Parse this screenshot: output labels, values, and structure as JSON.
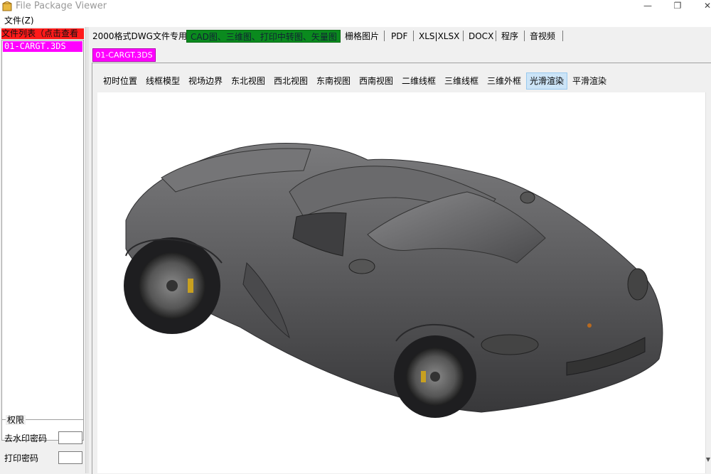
{
  "window": {
    "title": "File Package Viewer",
    "minimize_glyph": "—",
    "restore_glyph": "❐",
    "close_glyph": "✕"
  },
  "menu": {
    "file": "文件(Z)"
  },
  "file_list": {
    "header": "文件列表（点击查看",
    "items": [
      "01-CARGT.3DS"
    ]
  },
  "permissions": {
    "legend": "权限",
    "remove_watermark_label": "去水印密码",
    "print_password_label": "打印密码",
    "remove_watermark_value": "",
    "print_password_value": ""
  },
  "top_tabs": [
    "2000格式DWG文件专用",
    "CAD图、三维图、打印中转图、矢量图",
    "栅格图片",
    "PDF",
    "XLS|XLSX",
    "DOCX",
    "程序",
    "音视频"
  ],
  "doc_tab": "01-CARGT.3DS",
  "view_toolbar": [
    "初时位置",
    "线框模型",
    "视场边界",
    "东北视图",
    "西北视图",
    "东南视图",
    "西南视图",
    "二维线框",
    "三维线框",
    "三维外框",
    "光滑渲染",
    "平滑渲染"
  ],
  "active_view": "光滑渲染",
  "colors": {
    "file_item_bg": "#ff00ff",
    "list_header_bg": "#ff1a1a",
    "active_category_tab": "#0a8a1e",
    "active_view_bg": "#cce4f7",
    "car_body": "#5a5a5c"
  },
  "icons": {
    "app": "package-icon",
    "model": "sports-car-3d-render"
  }
}
